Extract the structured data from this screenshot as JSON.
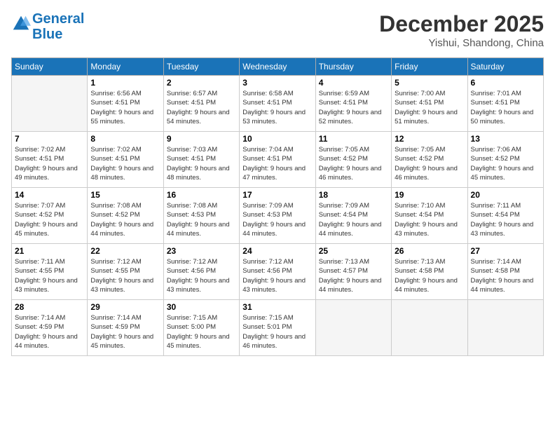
{
  "header": {
    "logo_line1": "General",
    "logo_line2": "Blue",
    "month": "December 2025",
    "location": "Yishui, Shandong, China"
  },
  "weekdays": [
    "Sunday",
    "Monday",
    "Tuesday",
    "Wednesday",
    "Thursday",
    "Friday",
    "Saturday"
  ],
  "weeks": [
    [
      {
        "day": "",
        "empty": true
      },
      {
        "day": "1",
        "sunrise": "6:56 AM",
        "sunset": "4:51 PM",
        "daylight": "9 hours and 55 minutes."
      },
      {
        "day": "2",
        "sunrise": "6:57 AM",
        "sunset": "4:51 PM",
        "daylight": "9 hours and 54 minutes."
      },
      {
        "day": "3",
        "sunrise": "6:58 AM",
        "sunset": "4:51 PM",
        "daylight": "9 hours and 53 minutes."
      },
      {
        "day": "4",
        "sunrise": "6:59 AM",
        "sunset": "4:51 PM",
        "daylight": "9 hours and 52 minutes."
      },
      {
        "day": "5",
        "sunrise": "7:00 AM",
        "sunset": "4:51 PM",
        "daylight": "9 hours and 51 minutes."
      },
      {
        "day": "6",
        "sunrise": "7:01 AM",
        "sunset": "4:51 PM",
        "daylight": "9 hours and 50 minutes."
      }
    ],
    [
      {
        "day": "7",
        "sunrise": "7:02 AM",
        "sunset": "4:51 PM",
        "daylight": "9 hours and 49 minutes."
      },
      {
        "day": "8",
        "sunrise": "7:02 AM",
        "sunset": "4:51 PM",
        "daylight": "9 hours and 48 minutes."
      },
      {
        "day": "9",
        "sunrise": "7:03 AM",
        "sunset": "4:51 PM",
        "daylight": "9 hours and 48 minutes."
      },
      {
        "day": "10",
        "sunrise": "7:04 AM",
        "sunset": "4:51 PM",
        "daylight": "9 hours and 47 minutes."
      },
      {
        "day": "11",
        "sunrise": "7:05 AM",
        "sunset": "4:52 PM",
        "daylight": "9 hours and 46 minutes."
      },
      {
        "day": "12",
        "sunrise": "7:05 AM",
        "sunset": "4:52 PM",
        "daylight": "9 hours and 46 minutes."
      },
      {
        "day": "13",
        "sunrise": "7:06 AM",
        "sunset": "4:52 PM",
        "daylight": "9 hours and 45 minutes."
      }
    ],
    [
      {
        "day": "14",
        "sunrise": "7:07 AM",
        "sunset": "4:52 PM",
        "daylight": "9 hours and 45 minutes."
      },
      {
        "day": "15",
        "sunrise": "7:08 AM",
        "sunset": "4:52 PM",
        "daylight": "9 hours and 44 minutes."
      },
      {
        "day": "16",
        "sunrise": "7:08 AM",
        "sunset": "4:53 PM",
        "daylight": "9 hours and 44 minutes."
      },
      {
        "day": "17",
        "sunrise": "7:09 AM",
        "sunset": "4:53 PM",
        "daylight": "9 hours and 44 minutes."
      },
      {
        "day": "18",
        "sunrise": "7:09 AM",
        "sunset": "4:54 PM",
        "daylight": "9 hours and 44 minutes."
      },
      {
        "day": "19",
        "sunrise": "7:10 AM",
        "sunset": "4:54 PM",
        "daylight": "9 hours and 43 minutes."
      },
      {
        "day": "20",
        "sunrise": "7:11 AM",
        "sunset": "4:54 PM",
        "daylight": "9 hours and 43 minutes."
      }
    ],
    [
      {
        "day": "21",
        "sunrise": "7:11 AM",
        "sunset": "4:55 PM",
        "daylight": "9 hours and 43 minutes."
      },
      {
        "day": "22",
        "sunrise": "7:12 AM",
        "sunset": "4:55 PM",
        "daylight": "9 hours and 43 minutes."
      },
      {
        "day": "23",
        "sunrise": "7:12 AM",
        "sunset": "4:56 PM",
        "daylight": "9 hours and 43 minutes."
      },
      {
        "day": "24",
        "sunrise": "7:12 AM",
        "sunset": "4:56 PM",
        "daylight": "9 hours and 43 minutes."
      },
      {
        "day": "25",
        "sunrise": "7:13 AM",
        "sunset": "4:57 PM",
        "daylight": "9 hours and 44 minutes."
      },
      {
        "day": "26",
        "sunrise": "7:13 AM",
        "sunset": "4:58 PM",
        "daylight": "9 hours and 44 minutes."
      },
      {
        "day": "27",
        "sunrise": "7:14 AM",
        "sunset": "4:58 PM",
        "daylight": "9 hours and 44 minutes."
      }
    ],
    [
      {
        "day": "28",
        "sunrise": "7:14 AM",
        "sunset": "4:59 PM",
        "daylight": "9 hours and 44 minutes."
      },
      {
        "day": "29",
        "sunrise": "7:14 AM",
        "sunset": "4:59 PM",
        "daylight": "9 hours and 45 minutes."
      },
      {
        "day": "30",
        "sunrise": "7:15 AM",
        "sunset": "5:00 PM",
        "daylight": "9 hours and 45 minutes."
      },
      {
        "day": "31",
        "sunrise": "7:15 AM",
        "sunset": "5:01 PM",
        "daylight": "9 hours and 46 minutes."
      },
      {
        "day": "",
        "empty": true
      },
      {
        "day": "",
        "empty": true
      },
      {
        "day": "",
        "empty": true
      }
    ]
  ],
  "labels": {
    "sunrise": "Sunrise:",
    "sunset": "Sunset:",
    "daylight": "Daylight:"
  }
}
